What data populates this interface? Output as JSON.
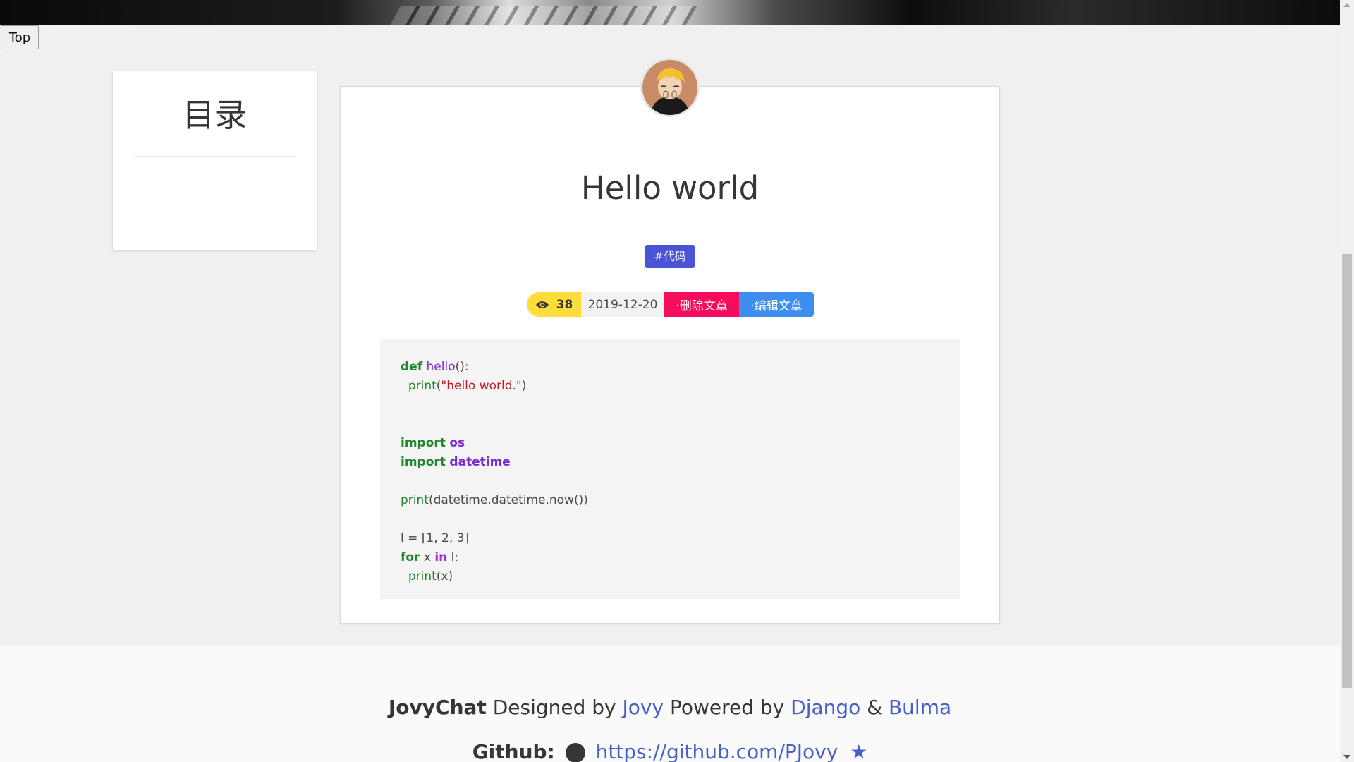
{
  "nav": {
    "top_button": "Top"
  },
  "toc": {
    "title": "目录"
  },
  "post": {
    "title": "Hello world",
    "tag": "#代码",
    "views": "38",
    "date": "2019-12-20",
    "delete_label": "·删除文章",
    "edit_label": "·编辑文章",
    "icons": {
      "views": "eye-icon",
      "avatar": "cartoon-avatar"
    },
    "colors": {
      "tag": "#4b54d6",
      "views": "#fddd3a",
      "delete": "#f30d5c",
      "edit": "#3e8ef0"
    }
  },
  "code": {
    "l1_kw": "def",
    "l1_fn": "hello",
    "l1_rest": "():",
    "l2_fn": "print",
    "l2_open": "(",
    "l2_str": "\"hello world.\"",
    "l2_close": ")",
    "l3_kw": "import",
    "l3_mod": "os",
    "l4_kw": "import",
    "l4_mod": "datetime",
    "l5_fn": "print",
    "l5_rest": "(datetime.datetime.now())",
    "l6": "l = [1, 2, 3]",
    "l7_kw": "for",
    "l7_x": " x ",
    "l7_in": "in",
    "l7_rest": " l:",
    "l8_fn": "print",
    "l8_rest": "(x)"
  },
  "footer": {
    "brand": "JovyChat",
    "designed_by": "Designed by",
    "author": "Jovy",
    "powered_by": "Powered by",
    "django": "Django",
    "amp": "&",
    "bulma": "Bulma",
    "github_label": "Github:",
    "github_url": "https://github.com/PJovy",
    "link_color": "#485fc7",
    "icons": {
      "github": "github-icon",
      "star": "star-icon"
    }
  }
}
